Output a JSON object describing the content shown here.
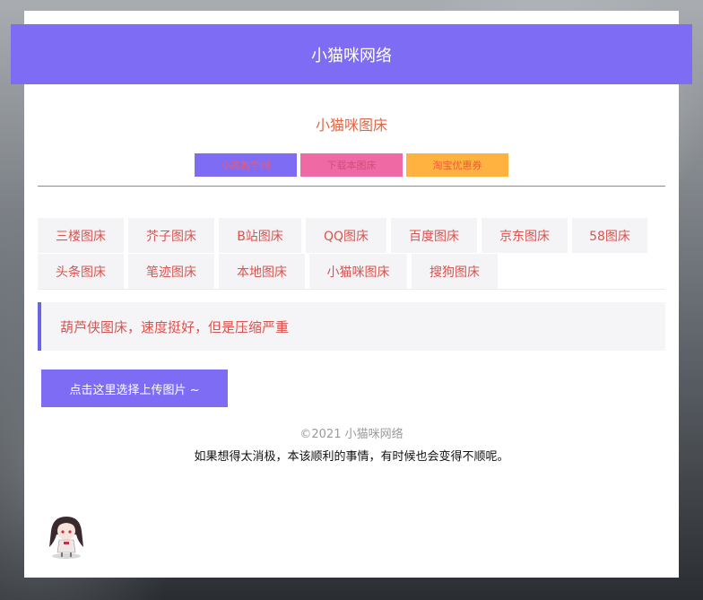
{
  "header": {
    "title": "小猫咪网络"
  },
  "site": {
    "title": "小猫咪图床"
  },
  "links": [
    {
      "label": "小高教学网",
      "bg": "#7e6cf4",
      "color": "#e85a7a"
    },
    {
      "label": "下载本图床",
      "bg": "#ef6aa5",
      "color": "#d24d7a"
    },
    {
      "label": "淘宝优惠券",
      "bg": "#ffb23f",
      "color": "#ec5d35"
    }
  ],
  "tabs": [
    [
      "三楼图床",
      "芥子图床",
      "B站图床",
      "QQ图床",
      "百度图床",
      "京东图床",
      "58图床"
    ],
    [
      "头条图床",
      "笔迹图床",
      "本地图床",
      "小猫咪图床",
      "搜狗图床"
    ]
  ],
  "notice": {
    "text": "葫芦侠图床，速度挺好，但是压缩严重"
  },
  "upload": {
    "label": "点击这里选择上传图片 ~"
  },
  "footer": {
    "copyright": "©2021 小猫咪网络",
    "quote": "如果想得太消极，本该顺利的事情，有时候也会变得不顺呢。"
  }
}
